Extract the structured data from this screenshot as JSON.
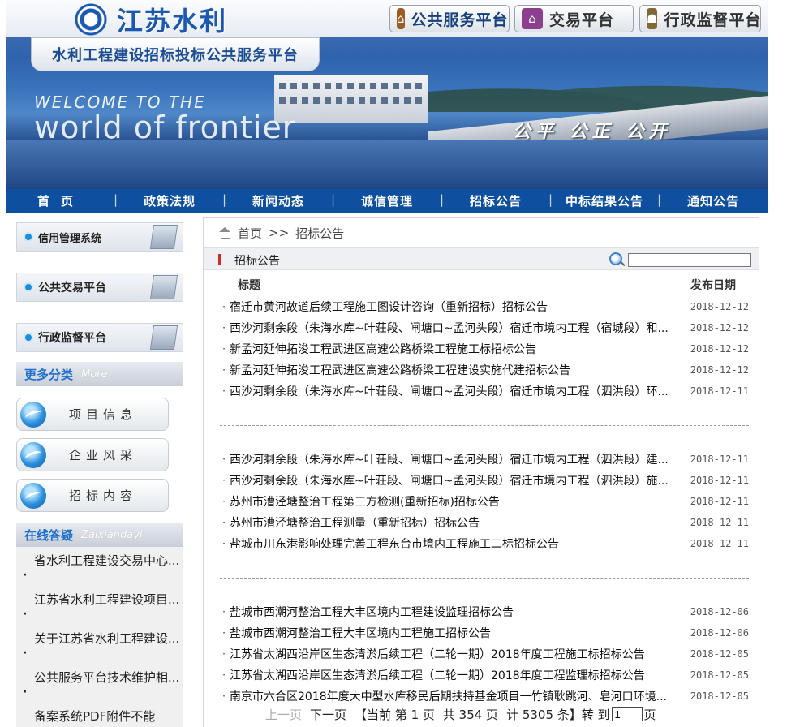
{
  "header": {
    "logo_text": "江苏水利",
    "platform_title": "水利工程建设招标投标公共服务平台",
    "welcome": "WELCOME TO THE",
    "world": "world of frontier",
    "slogan": "公平 公正 公开",
    "platform_buttons": [
      {
        "label": "公共服务平台",
        "icon": "house-icon",
        "color": "#9c5b24"
      },
      {
        "label": "交易平台",
        "icon": "home-icon",
        "color": "#8b3f8e"
      },
      {
        "label": "行政监督平台",
        "icon": "people-icon",
        "color": "#7d6a36"
      }
    ]
  },
  "nav": [
    "首页",
    "政策法规",
    "新闻动态",
    "诚信管理",
    "招标公告",
    "中标结果公告",
    "通知公告"
  ],
  "sidebar": {
    "systems": [
      "信用管理系统",
      "公共交易平台",
      "行政监督平台"
    ],
    "more_head": {
      "cn": "更多分类",
      "en": "More"
    },
    "categories": [
      "项目信息",
      "企业风采",
      "招标内容"
    ],
    "qa_head": {
      "cn": "在线答疑",
      "en": "Zaixiandayi"
    },
    "qa_items": [
      "省水利工程建设交易中心...",
      "江苏省水利工程建设项目...",
      "关于江苏省水利工程建设...",
      "公共服务平台技术维护相...",
      "备案系统PDF附件不能"
    ]
  },
  "main": {
    "breadcrumb": {
      "home": "首页",
      "sep": ">>",
      "current": "招标公告"
    },
    "section_title": "招标公告",
    "search": {
      "value": ""
    },
    "columns": {
      "title": "标题",
      "date": "发布日期"
    },
    "groups": [
      [
        {
          "title": "宿迁市黄河故道后续工程施工图设计咨询（重新招标）招标公告",
          "date": "2018-12-12"
        },
        {
          "title": "西沙河剩余段（朱海水库~叶荘段、闸塘口~孟河头段）宿迁市境内工程（宿城段）和...",
          "date": "2018-12-12"
        },
        {
          "title": "新孟河延伸拓浚工程武进区高速公路桥梁工程施工标招标公告",
          "date": "2018-12-12"
        },
        {
          "title": "新孟河延伸拓浚工程武进区高速公路桥梁工程建设实施代建招标公告",
          "date": "2018-12-12"
        },
        {
          "title": "西沙河剩余段（朱海水库~叶荘段、闸塘口~孟河头段）宿迁市境内工程（泗洪段）环...",
          "date": "2018-12-11"
        }
      ],
      [
        {
          "title": "西沙河剩余段（朱海水库~叶荘段、闸塘口~孟河头段）宿迁市境内工程（泗洪段）建...",
          "date": "2018-12-11"
        },
        {
          "title": "西沙河剩余段（朱海水库~叶荘段、闸塘口~孟河头段）宿迁市境内工程（泗洪段）施...",
          "date": "2018-12-11"
        },
        {
          "title": "苏州市漕泾塘整治工程第三方检测(重新招标)招标公告",
          "date": "2018-12-11"
        },
        {
          "title": "苏州市漕泾塘整治工程测量（重新招标）招标公告",
          "date": "2018-12-11"
        },
        {
          "title": "盐城市川东港影响处理完善工程东台市境内工程施工二标招标公告",
          "date": "2018-12-11"
        }
      ],
      [
        {
          "title": "盐城市西潮河整治工程大丰区境内工程建设监理招标公告",
          "date": "2018-12-06"
        },
        {
          "title": "盐城市西潮河整治工程大丰区境内工程施工招标公告",
          "date": "2018-12-06"
        },
        {
          "title": "江苏省太湖西沿岸区生态清淤后续工程（二轮一期）2018年度工程施工标招标公告",
          "date": "2018-12-05"
        },
        {
          "title": "江苏省太湖西沿岸区生态清淤后续工程（二轮一期）2018年度工程监理标招标公告",
          "date": "2018-12-05"
        },
        {
          "title": "南京市六合区2018年度大中型水库移民后期扶持基金项目一竹镇耿跳河、皂河口环境...",
          "date": "2018-12-05"
        }
      ]
    ],
    "pager": {
      "prev": "上一页",
      "next": "下一页",
      "current": "【当前 第 1 页",
      "total_pages": "共 354 页",
      "total_items": "计 5305 条】转 到",
      "page_value": "1",
      "page_suffix": "页"
    }
  }
}
